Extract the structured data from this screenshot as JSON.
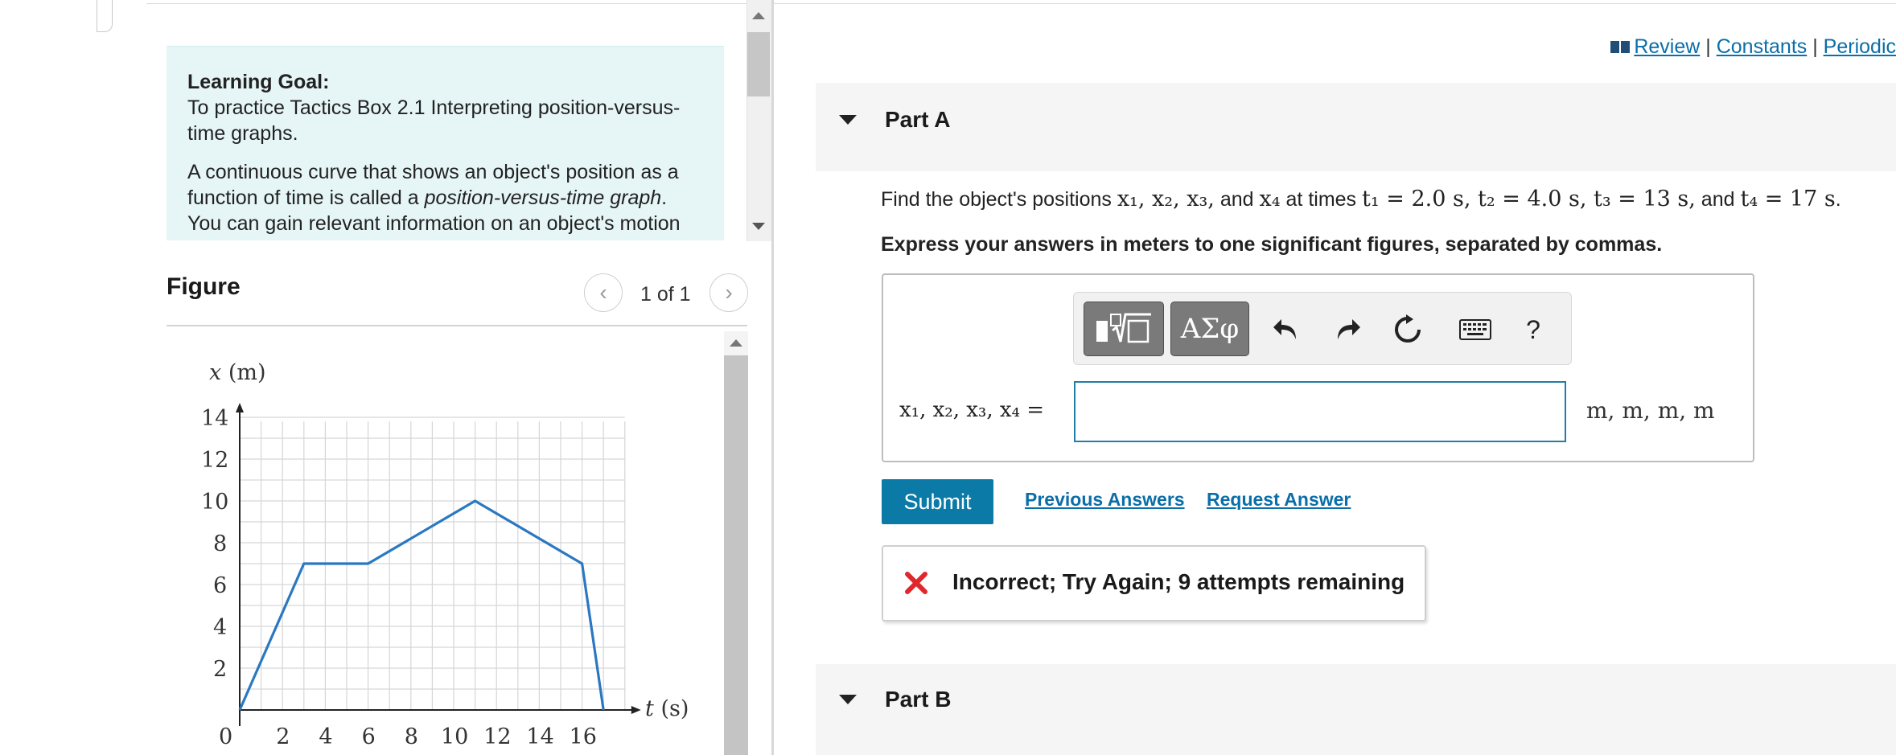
{
  "colors": {
    "accent": "#0b7aa6",
    "link": "#0a6ea8",
    "goal_background": "#e6f5f6",
    "graph_line": "#2a78c2",
    "error_red": "#e0272b"
  },
  "top_links": {
    "review": "Review",
    "sep1": "|",
    "constants": "Constants",
    "sep2": "|",
    "periodic": "Periodic"
  },
  "learning_goal": {
    "title": "Learning Goal:",
    "line1": "To practice Tactics Box 2.1 Interpreting position-versus-time graphs.",
    "line2_before": "A continuous curve that shows an object's position as a function of time is called a ",
    "line2_em": "position-versus-time graph",
    "line2_after": ". You can gain relevant information on an object's motion"
  },
  "figure": {
    "title": "Figure",
    "pager": "1 of 1",
    "prev_icon": "chevron-left-icon",
    "next_icon": "chevron-right-icon"
  },
  "chart_data": {
    "type": "line",
    "title": "",
    "xlabel": "t (s)",
    "ylabel": "x (m)",
    "xlim": [
      0,
      18
    ],
    "ylim": [
      0,
      14
    ],
    "x_ticks": [
      "0",
      "2",
      "4",
      "6",
      "8",
      "10",
      "12",
      "14",
      "16"
    ],
    "y_ticks": [
      "2",
      "4",
      "6",
      "8",
      "10",
      "12",
      "14"
    ],
    "grid": true,
    "series": [
      {
        "points": [
          [
            0,
            0
          ],
          [
            3,
            7
          ],
          [
            6,
            7
          ],
          [
            11,
            10
          ],
          [
            16,
            7
          ],
          [
            17,
            0
          ]
        ]
      }
    ]
  },
  "part_a": {
    "label": "Part A",
    "question": {
      "prefix": "Find the object's positions ",
      "vars": "x₁, x₂, x₃,",
      "and1": " and ",
      "var4": "x₄",
      "middle": " at times ",
      "t1": "t₁ = 2.0 s, t₂ = 4.0 s, t₃ = 13 s,",
      "and2": " and ",
      "t4": "t₄ = 17 s",
      "end": "."
    },
    "instruction": "Express your answers in meters to one significant figures, separated by commas.",
    "toolbar": {
      "template_icon": "templates-icon",
      "symbols_label": "ΑΣφ",
      "undo_icon": "undo-icon",
      "redo_icon": "redo-icon",
      "reset_icon": "reset-icon",
      "keyboard_icon": "keyboard-icon",
      "help_label": "?"
    },
    "answer_label": "x₁, x₂, x₃, x₄ =",
    "answer_value": "",
    "units": "m, m, m, m",
    "submit_label": "Submit",
    "previous_answers": "Previous Answers",
    "request_answer": "Request Answer",
    "feedback": "Incorrect; Try Again; 9 attempts remaining"
  },
  "part_b": {
    "label": "Part B"
  }
}
